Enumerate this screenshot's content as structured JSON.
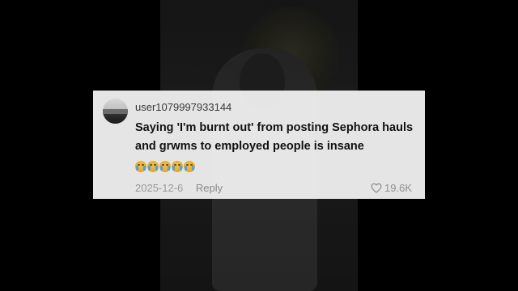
{
  "comment": {
    "username": "user1079997933144",
    "text": "Saying 'I'm burnt out' from posting Sephora hauls and grwms to employed people is insane",
    "emojis": [
      "loudly-crying-face",
      "loudly-crying-face",
      "loudly-crying-face",
      "loudly-crying-face",
      "loudly-crying-face"
    ],
    "date": "2025-12-6",
    "reply_label": "Reply",
    "like_count": "19.6K",
    "like_icon": "heart-outline-icon"
  }
}
